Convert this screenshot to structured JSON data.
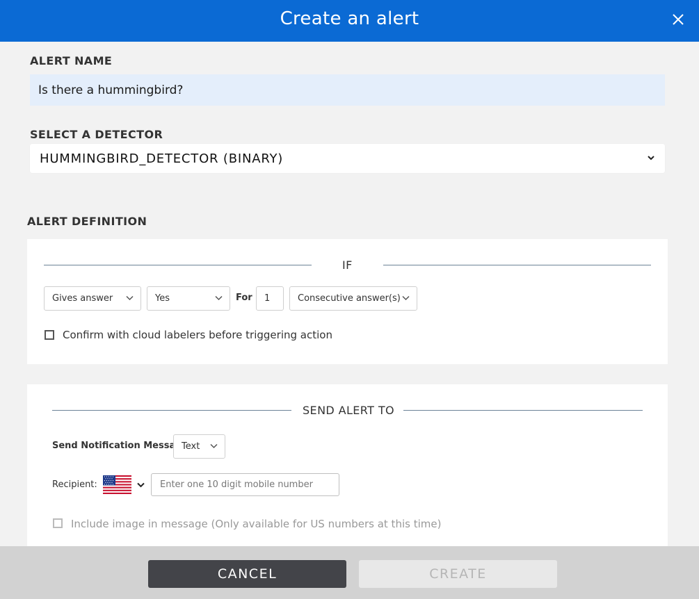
{
  "header": {
    "title": "Create an alert"
  },
  "alert_name": {
    "label": "ALERT NAME",
    "value": "Is there a hummingbird?"
  },
  "detector": {
    "label": "SELECT A DETECTOR",
    "selected": "HUMMINGBIRD_DETECTOR (BINARY)"
  },
  "definition": {
    "label": "ALERT DEFINITION",
    "if_label": "IF",
    "condition_select": "Gives answer",
    "answer_select": "Yes",
    "for_label": "For",
    "count_value": "1",
    "mode_select": "Consecutive answer(s)",
    "confirm_label": "Confirm with cloud labelers before triggering action",
    "confirm_checked": false
  },
  "send": {
    "title": "SEND ALERT TO",
    "notification_label": "Send Notification Message",
    "notification_select": "Text",
    "recipient_label": "Recipient:",
    "country_flag": "us-flag-icon",
    "phone_placeholder": "Enter one 10 digit mobile number",
    "include_image_label": "Include image in message (Only available for US numbers at this time)",
    "include_image_checked": false
  },
  "footer": {
    "cancel_label": "CANCEL",
    "create_label": "CREATE",
    "create_enabled": false
  },
  "colors": {
    "header_bg": "#0b6ad4",
    "input_bg": "#e4eefb",
    "cancel_bg": "#434449",
    "footer_bg": "#d2d2d2"
  }
}
